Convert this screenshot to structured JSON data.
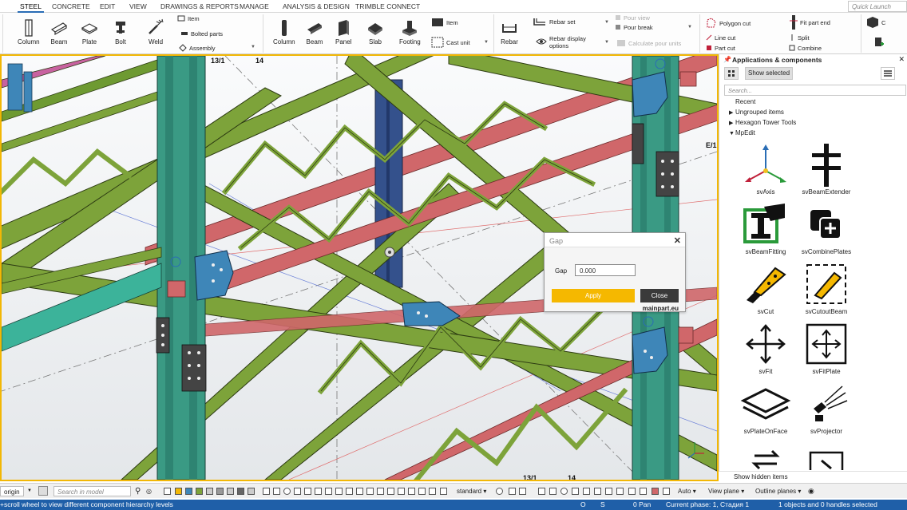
{
  "menu": {
    "steel": "STEEL",
    "concrete": "CONCRETE",
    "edit": "EDIT",
    "view": "VIEW",
    "drawings": "DRAWINGS & REPORTS",
    "manage": "MANAGE",
    "analysis": "ANALYSIS & DESIGN",
    "trimble": "TRIMBLE CONNECT",
    "quick_launch_placeholder": "Quick Launch"
  },
  "ribbon": {
    "steel": {
      "column": "Column",
      "beam": "Beam",
      "plate": "Plate",
      "bolt": "Bolt",
      "weld": "Weld",
      "item": "Item",
      "bolted_parts": "Bolted parts",
      "assembly": "Assembly"
    },
    "concrete": {
      "column": "Column",
      "beam": "Beam",
      "panel": "Panel",
      "slab": "Slab",
      "footing": "Footing",
      "item": "Item",
      "cast_unit": "Cast unit"
    },
    "rebar": {
      "rebar": "Rebar",
      "rebar_set": "Rebar set",
      "rebar_display": "Rebar display options",
      "pour_view": "Pour view",
      "pour_break": "Pour break",
      "calc_pour": "Calculate pour units"
    },
    "edit": {
      "polygon_cut": "Polygon cut",
      "fit_part_end": "Fit part end",
      "line_cut": "Line cut",
      "split": "Split",
      "part_cut": "Part cut",
      "combine": "Combine",
      "more": "C"
    }
  },
  "viewport": {
    "grid_labels": {
      "top_13": "13/1",
      "top_14": "14",
      "right_e": "E/1",
      "bottom_13": "13/1",
      "bottom_14": "14"
    }
  },
  "gap_dialog": {
    "title": "Gap",
    "label": "Gap",
    "value": "0.000",
    "apply": "Apply",
    "close": "Close",
    "brand": "mainpart.eu"
  },
  "side_panel": {
    "title": "Applications & components",
    "show_selected": "Show selected",
    "search_placeholder": "Search...",
    "tree": {
      "recent": "Recent",
      "ungrouped": "Ungrouped items",
      "hexagon": "Hexagon Tower Tools",
      "mpedit": "MpEdit"
    },
    "components": [
      "svAxis",
      "svBeamExtender",
      "svBeamFitting",
      "svCombinePlates",
      "svCut",
      "svCutoutBeam",
      "svFit",
      "svFitPlate",
      "svPlateOnFace",
      "svProjector"
    ],
    "show_hidden": "Show hidden items"
  },
  "bottom_toolbar": {
    "origin": "origin",
    "search_model_placeholder": "Search in model",
    "standard": "standard",
    "auto": "Auto",
    "view_plane": "View plane",
    "outline_planes": "Outline planes"
  },
  "status": {
    "hint": "+scroll wheel to view different component hierarchy levels",
    "o": "O",
    "s": "S",
    "pan": "0 Pan",
    "phase": "Current phase: 1, Стадия 1",
    "selection": "1 objects and 0 handles selected"
  },
  "colors": {
    "accent": "#2a6db5",
    "viewport_border": "#f2b705",
    "beam_green": "#7da33a",
    "column_teal": "#3a9a84",
    "rail_red": "#d0676a",
    "plate_blue": "#3e86b8",
    "apply": "#f5b800"
  }
}
